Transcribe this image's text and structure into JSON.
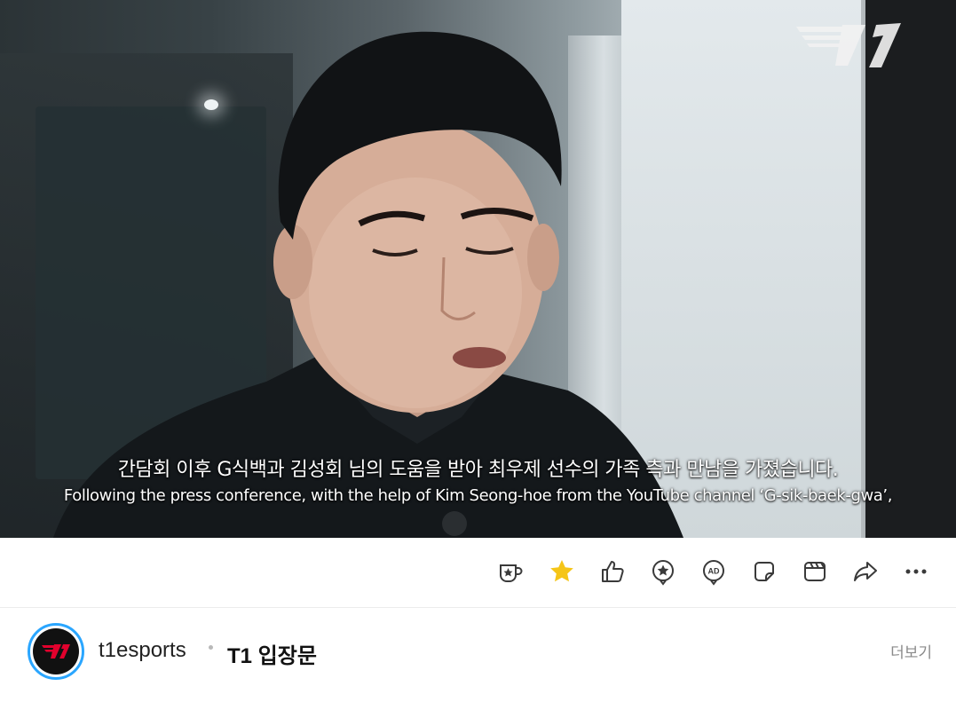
{
  "video": {
    "brand_logo_alt": "T1",
    "subtitle_korean": "간담회 이후 G식백과 김성회 님의 도움을 받아 최우제 선수의 가족 측과 만남을 가졌습니다.",
    "subtitle_english": "Following the press conference, with the help of Kim Seong-hoe from the YouTube channel ‘G-sik-baek-gwa’,"
  },
  "toolbar": {
    "icons": [
      "coffee-cup-icon",
      "star-filled-icon",
      "thumbs-up-icon",
      "badge-star-icon",
      "ad-icon",
      "sticker-icon",
      "clapperboard-icon",
      "share-icon",
      "more-dots-icon"
    ],
    "colors": {
      "star": "#f5c518",
      "icon": "#3a3a3a"
    }
  },
  "channel": {
    "name": "t1esports",
    "separator": "•",
    "post_title": "T1 입장문",
    "more_label": "더보기",
    "avatar_ring_color": "#2aa6ff",
    "logo_text": "T1"
  }
}
